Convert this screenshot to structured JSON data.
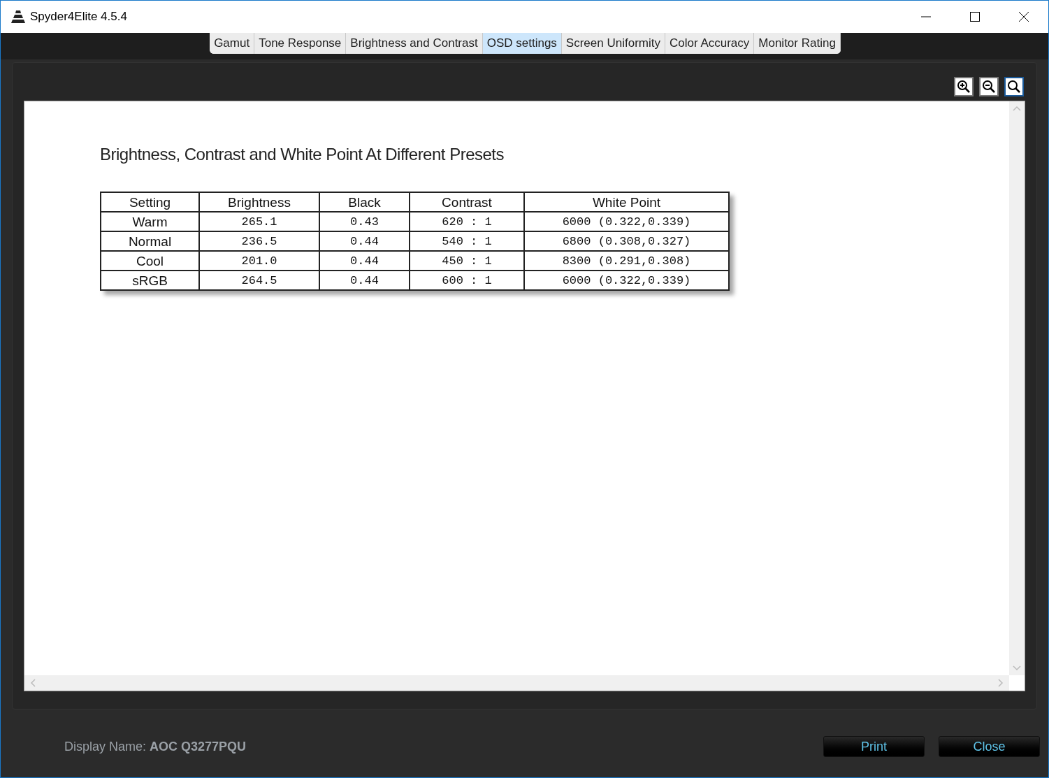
{
  "window": {
    "title": "Spyder4Elite 4.5.4"
  },
  "tabs": [
    {
      "label": "Gamut",
      "selected": false
    },
    {
      "label": "Tone Response",
      "selected": false
    },
    {
      "label": "Brightness and Contrast",
      "selected": false
    },
    {
      "label": "OSD settings",
      "selected": true
    },
    {
      "label": "Screen Uniformity",
      "selected": false
    },
    {
      "label": "Color Accuracy",
      "selected": false
    },
    {
      "label": "Monitor Rating",
      "selected": false
    }
  ],
  "zoom_buttons": [
    {
      "kind": "zoom-in",
      "selected": false
    },
    {
      "kind": "zoom-out",
      "selected": false
    },
    {
      "kind": "fit",
      "selected": true
    }
  ],
  "report": {
    "title": "Brightness, Contrast and White Point At Different Presets",
    "table": {
      "columns": [
        "Setting",
        "Brightness",
        "Black",
        "Contrast",
        "White Point"
      ],
      "rows": [
        [
          "Warm",
          "265.1",
          "0.43",
          "620 : 1",
          "6000 (0.322,0.339)"
        ],
        [
          "Normal",
          "236.5",
          "0.44",
          "540 : 1",
          "6800 (0.308,0.327)"
        ],
        [
          "Cool",
          "201.0",
          "0.44",
          "450 : 1",
          "8300 (0.291,0.308)"
        ],
        [
          "sRGB",
          "264.5",
          "0.44",
          "600 : 1",
          "6000 (0.322,0.339)"
        ]
      ]
    }
  },
  "display_name": "Display Name: **AOC Q3277PQU**",
  "buttons": [
    "Print",
    "Close"
  ]
}
